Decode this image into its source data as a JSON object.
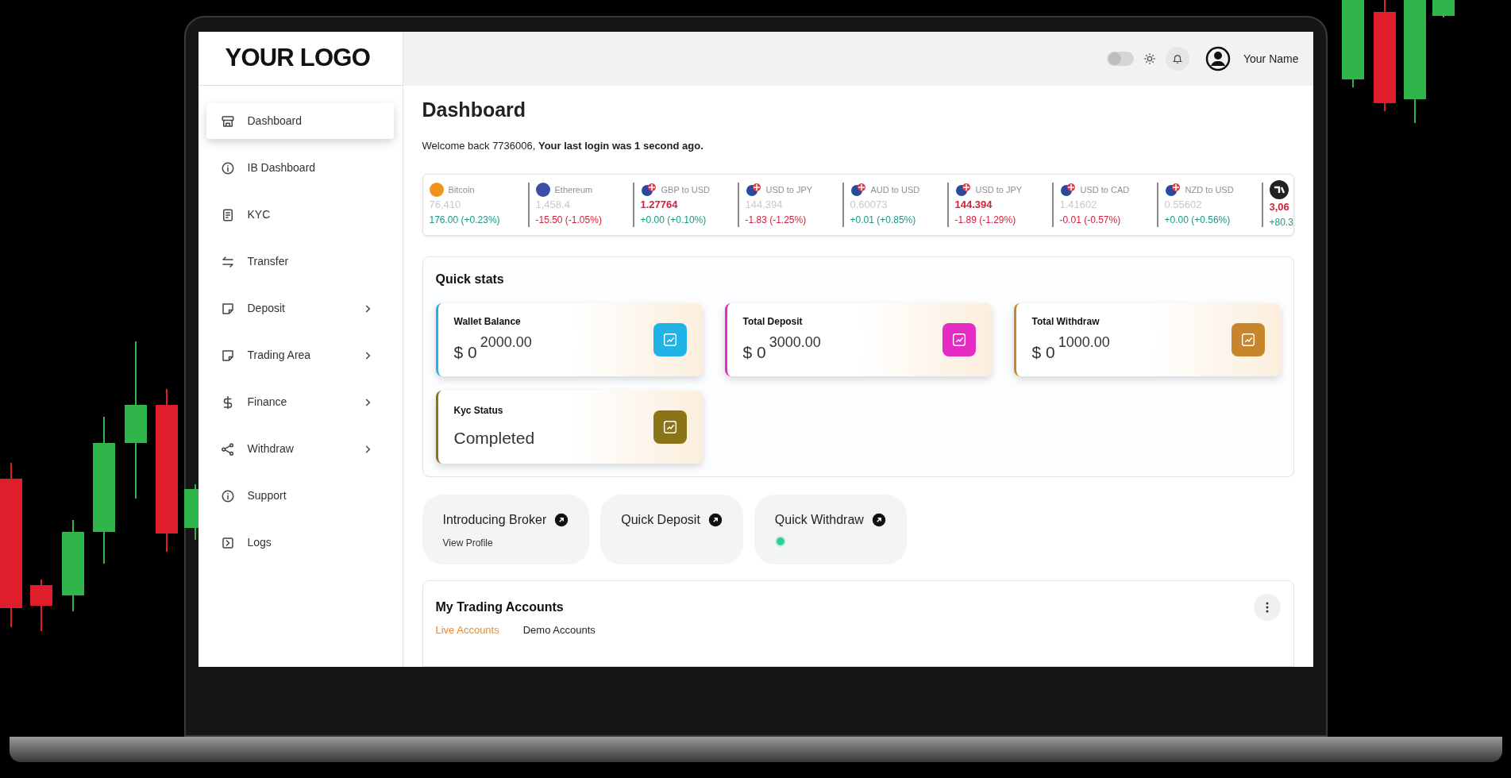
{
  "logo": "YOUR LOGO",
  "header": {
    "theme_toggle": {
      "on": false
    },
    "user_name": "Your Name"
  },
  "sidebar": {
    "items": [
      {
        "label": "Dashboard",
        "selected": true,
        "expandable": false
      },
      {
        "label": "IB Dashboard",
        "selected": false,
        "expandable": false
      },
      {
        "label": "KYC",
        "selected": false,
        "expandable": false
      },
      {
        "label": "Transfer",
        "selected": false,
        "expandable": false
      },
      {
        "label": "Deposit",
        "selected": false,
        "expandable": true
      },
      {
        "label": "Trading Area",
        "selected": false,
        "expandable": true
      },
      {
        "label": "Finance",
        "selected": false,
        "expandable": true
      },
      {
        "label": "Withdraw",
        "selected": false,
        "expandable": true
      },
      {
        "label": "Support",
        "selected": false,
        "expandable": false
      },
      {
        "label": "Logs",
        "selected": false,
        "expandable": false
      }
    ]
  },
  "page": {
    "title": "Dashboard",
    "welcome": "Welcome back 7736006, **Your last login was 1 second ago.**"
  },
  "ticker": [
    {
      "kind": "coin",
      "color": "#f0931b",
      "name": "Bitcoin",
      "value": "76,410",
      "highlighted": false,
      "change": "176.00 (+0.23%)",
      "rising": true
    },
    {
      "kind": "coin",
      "color": "#3b4fa8",
      "name": "Ethereum",
      "value": "1,458.4",
      "highlighted": false,
      "change": "-15.50 (-1.05%)",
      "rising": false
    },
    {
      "kind": "flag",
      "name": "GBP to USD",
      "value": "1.27764",
      "highlighted": true,
      "change": "+0.00 (+0.10%)",
      "rising": true
    },
    {
      "kind": "flag",
      "name": "USD to JPY",
      "value": "144.394",
      "highlighted": false,
      "change": "-1.83 (-1.25%)",
      "rising": false
    },
    {
      "kind": "flag",
      "name": "AUD to USD",
      "value": "0.60073",
      "highlighted": false,
      "change": "+0.01 (+0.85%)",
      "rising": true
    },
    {
      "kind": "flag",
      "name": "USD to JPY",
      "value": "144.394",
      "highlighted": true,
      "change": "-1.89 (-1.29%)",
      "rising": false
    },
    {
      "kind": "flag",
      "name": "USD to CAD",
      "value": "1.41602",
      "highlighted": false,
      "change": "-0.01 (-0.57%)",
      "rising": false
    },
    {
      "kind": "flag",
      "name": "NZD to USD",
      "value": "0.55602",
      "highlighted": false,
      "change": "+0.00 (+0.56%)",
      "rising": true
    },
    {
      "kind": "brand",
      "value": "3,06",
      "highlighted": true,
      "change": "+80.3",
      "rising": true
    }
  ],
  "quick_stats": {
    "title": "Quick stats",
    "cards": [
      {
        "label": "Wallet Balance",
        "value": "$ 0",
        "overlay": "2000.00",
        "color": "#1fb3e6"
      },
      {
        "label": "Total Deposit",
        "value": "$ 0",
        "overlay": "3000.00",
        "color": "#e42bc4"
      },
      {
        "label": "Total Withdraw",
        "value": "$ 0",
        "overlay": "1000.00",
        "color": "#c7862c"
      },
      {
        "label": "Kyc Status",
        "value": "Completed",
        "color": "#8b7417"
      }
    ]
  },
  "quick_links": [
    {
      "title": "Introducing Broker",
      "subtitle": "View Profile",
      "indicator": false
    },
    {
      "title": "Quick Deposit",
      "indicator": false
    },
    {
      "title": "Quick Withdraw",
      "indicator": true
    }
  ],
  "trading_accounts": {
    "title": "My Trading Accounts",
    "tabs": [
      {
        "label": "Live Accounts",
        "selected": true
      },
      {
        "label": "Demo Accounts",
        "selected": false
      }
    ]
  }
}
